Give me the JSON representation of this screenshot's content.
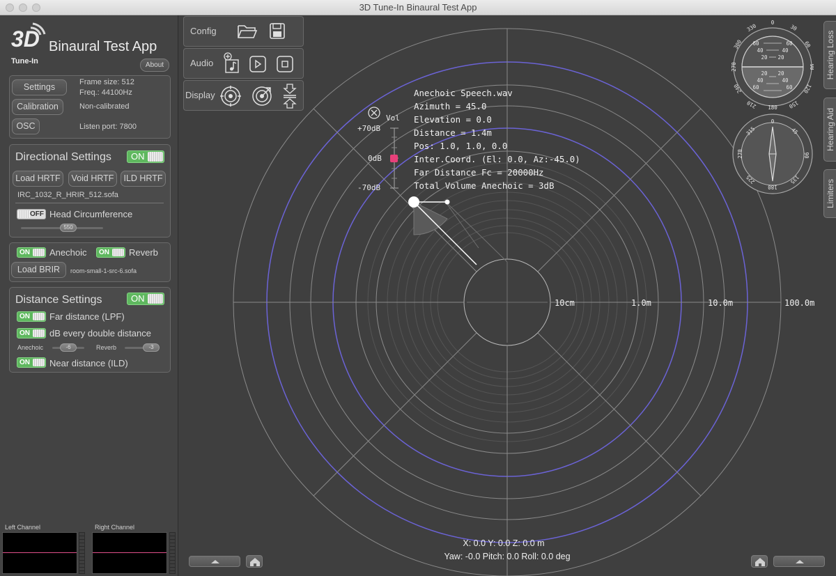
{
  "window": {
    "title": "3D Tune-In Binaural Test App"
  },
  "logo": {
    "mark": "3D",
    "tagline": "Tune-In",
    "app_name": "Binaural Test App",
    "about_label": "About"
  },
  "settings_panel": {
    "settings_label": "Settings",
    "calibration_label": "Calibration",
    "osc_label": "OSC",
    "frame_size": "Frame size:  512",
    "frequency": "Freq.: 44100Hz",
    "calibration_status": "Non-calibrated",
    "listen_port": "Listen port: 7800"
  },
  "directional": {
    "heading": "Directional Settings",
    "toggle": "ON",
    "load_hrtf": "Load HRTF",
    "void_hrtf": "Void HRTF",
    "ild_hrtf": "ILD HRTF",
    "hrtf_file": "IRC_1032_R_HRIR_512.sofa",
    "head_toggle": "OFF",
    "head_label": "Head Circumference",
    "head_value": "550"
  },
  "reverb_panel": {
    "anechoic_toggle": "ON",
    "anechoic_label": "Anechoic",
    "reverb_toggle": "ON",
    "reverb_label": "Reverb",
    "load_brir": "Load BRIR",
    "brir_file": "room-small-1-src-6.sofa"
  },
  "distance": {
    "heading": "Distance Settings",
    "toggle": "ON",
    "far_toggle": "ON",
    "far_label": "Far distance (LPF)",
    "db_toggle": "ON",
    "db_label": "dB every double distance",
    "anechoic_slider_label": "Anechoic",
    "anechoic_value": "-6",
    "reverb_slider_label": "Reverb",
    "reverb_value": "-3",
    "near_toggle": "ON",
    "near_label": "Near distance (ILD)"
  },
  "channels": {
    "left": "Left Channel",
    "right": "Right Channel"
  },
  "toolbar": {
    "config": "Config",
    "audio": "Audio",
    "display": "Display"
  },
  "source_info": [
    "Anechoic Speech.wav",
    "Azimuth = 45.0",
    "Elevation = 0.0",
    "Distance = 1.4m",
    "Pos: 1.0, 1.0, 0.0",
    "Inter.Coord. (El: 0.0, Az:-45.0)",
    "Far Distance Fc = 20000Hz",
    "Total Volume Anechoic = 3dB"
  ],
  "volume": {
    "label": "Vol",
    "max": "+70dB",
    "mid": "0dB",
    "min": "-70dB",
    "marker_color": "#e8407a"
  },
  "rings": {
    "r1": "10cm",
    "r2": "1.0m",
    "r3": "10.0m",
    "r4": "100.0m"
  },
  "listener": {
    "position": "X: 0.0  Y: 0.0  Z: 0.0 m",
    "orientation": "Yaw: -0.0 Pitch: 0.0 Roll: 0.0 deg"
  },
  "side_tabs": {
    "hearing_loss": "Hearing Loss",
    "hearing_aid": "Hearing Aid",
    "limiters": "Limiters"
  },
  "gauge_top": {
    "angles": [
      "0",
      "30",
      "60",
      "90",
      "120",
      "150",
      "180",
      "210",
      "240",
      "270",
      "300",
      "330"
    ],
    "scale_upper": [
      "60",
      "60",
      "40",
      "40",
      "20",
      "20"
    ],
    "scale_lower": [
      "20",
      "20",
      "40",
      "40",
      "60",
      "60"
    ]
  },
  "gauge_bottom": {
    "angles": [
      "0",
      "45",
      "90",
      "135",
      "180",
      "225",
      "270",
      "315"
    ]
  },
  "colors": {
    "accent_ring": "#6b63d6",
    "toggle_on": "#5fb85f",
    "channel_line": "#e0508a"
  }
}
